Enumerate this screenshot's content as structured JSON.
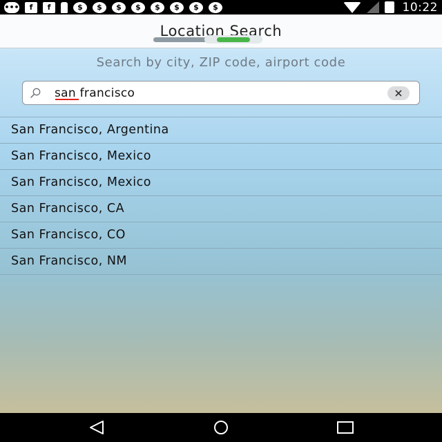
{
  "status_bar": {
    "time": "10:22",
    "icons": [
      "message-icon",
      "facebook-icon",
      "facebook-icon",
      "notification-icon",
      "dollar-icon",
      "dollar-icon",
      "dollar-icon",
      "dollar-icon",
      "dollar-icon",
      "dollar-icon",
      "dollar-icon",
      "dollar-icon",
      "wifi-icon",
      "signal-icon",
      "battery-icon"
    ]
  },
  "header": {
    "title": "Location Search"
  },
  "search": {
    "hint": "Search by city, ZIP code, airport code",
    "value": "san francisco"
  },
  "results": [
    {
      "label": "San Francisco, Argentina"
    },
    {
      "label": "San Francisco, Mexico"
    },
    {
      "label": "San Francisco, Mexico"
    },
    {
      "label": "San Francisco, CA"
    },
    {
      "label": "San Francisco, CO"
    },
    {
      "label": "San Francisco, NM"
    }
  ],
  "nav": {
    "icons": [
      "back-icon",
      "home-icon",
      "recents-icon"
    ]
  },
  "colors": {
    "accent_green": "#48b649",
    "spell_underline": "#e2231a"
  }
}
